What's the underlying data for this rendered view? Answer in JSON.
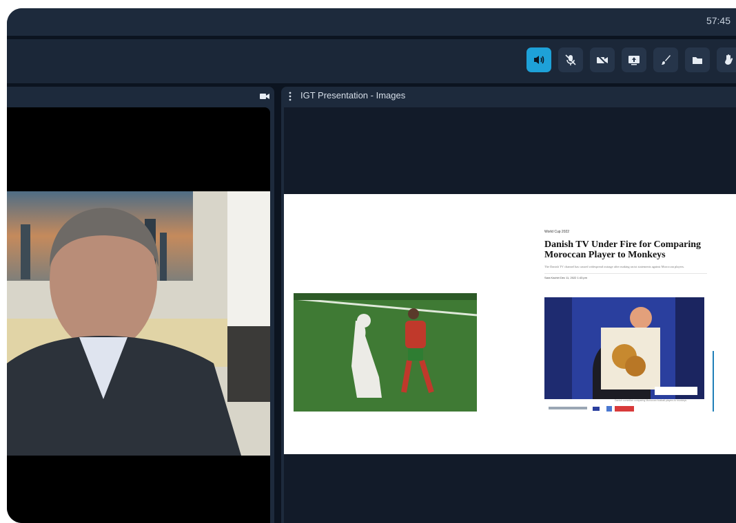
{
  "header": {
    "timer": "57:45"
  },
  "toolbar": {
    "buttons": [
      {
        "icon": "speaker-icon",
        "active": true
      },
      {
        "icon": "mic-off-icon",
        "active": false
      },
      {
        "icon": "camera-off-icon",
        "active": false
      },
      {
        "icon": "screen-share-icon",
        "active": false
      },
      {
        "icon": "brush-icon",
        "active": false
      },
      {
        "icon": "folder-icon",
        "active": false
      },
      {
        "icon": "raise-hand-icon",
        "active": false
      }
    ]
  },
  "video_panel": {
    "camera_icon": "camera-icon"
  },
  "presentation_panel": {
    "title": "IGT Presentation - Images",
    "slide": {
      "kicker": "World Cup 2022",
      "headline": "Danish TV Under Fire for Comparing Moroccan Player to Monkeys",
      "dek": "The Danish TV channel has caused widespread outrage after making racist statements against Moroccan players.",
      "byline": "Sara Kachiri   Dec 11, 2022 1:43 pm",
      "caption": "Danish comedian comparing Moroccan football players to monkeys"
    }
  },
  "colors": {
    "accent": "#1ea1d8",
    "background": "#0c1420",
    "panel": "#1d2a3c"
  }
}
